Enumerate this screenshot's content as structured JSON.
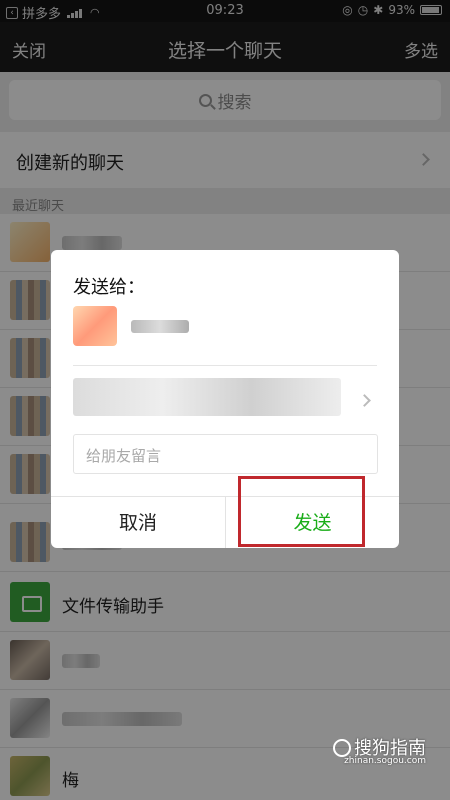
{
  "status_bar": {
    "back_app": "拼多多",
    "time": "09:23",
    "battery": "93%"
  },
  "nav": {
    "close_label": "关闭",
    "title": "选择一个聊天",
    "multi_select_label": "多选"
  },
  "search": {
    "placeholder": "搜索"
  },
  "new_chat": {
    "label": "创建新的聊天"
  },
  "recent_section": {
    "title": "最近聊天"
  },
  "chats": [
    {
      "name": ""
    },
    {
      "name": ""
    },
    {
      "name": ""
    },
    {
      "name": ""
    },
    {
      "name": ""
    },
    {
      "name": ""
    },
    {
      "name": "文件传输助手"
    },
    {
      "name": ""
    },
    {
      "name": ""
    },
    {
      "name": "梅"
    }
  ],
  "dialog": {
    "heading": "发送给：",
    "message_placeholder": "给朋友留言",
    "cancel_label": "取消",
    "send_label": "发送"
  },
  "colors": {
    "send_green": "#1aad19",
    "highlight_red": "#c0282d"
  },
  "watermark": {
    "logo": "搜狗指南",
    "url": "zhinan.sogou.com"
  }
}
